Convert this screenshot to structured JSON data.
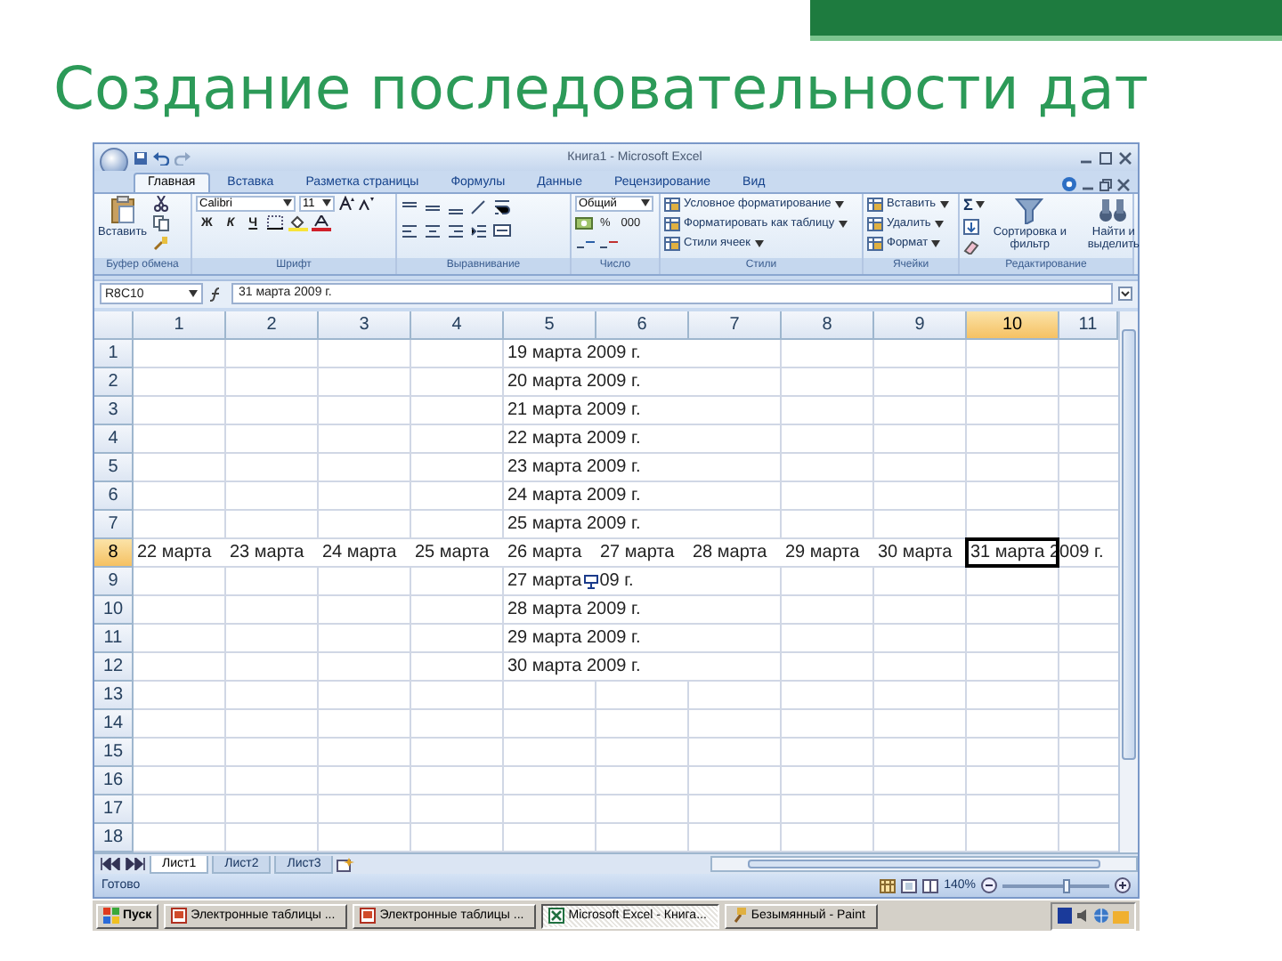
{
  "slide": {
    "title": "Создание последовательности дат"
  },
  "window": {
    "title": "Книга1 - Microsoft Excel"
  },
  "ribbon": {
    "tabs": [
      {
        "label": "Главная",
        "selected": true
      },
      {
        "label": "Вставка",
        "selected": false
      },
      {
        "label": "Разметка страницы",
        "selected": false
      },
      {
        "label": "Формулы",
        "selected": false
      },
      {
        "label": "Данные",
        "selected": false
      },
      {
        "label": "Рецензирование",
        "selected": false
      },
      {
        "label": "Вид",
        "selected": false
      }
    ],
    "groups": [
      {
        "name": "Буфер обмена",
        "kind": "clipboard",
        "label": "Вставить"
      },
      {
        "name": "Шрифт",
        "kind": "font",
        "font": "Calibri",
        "size": "11",
        "styles": [
          "Ж",
          "К",
          "Ч"
        ]
      },
      {
        "name": "Выравнивание",
        "kind": "align"
      },
      {
        "name": "Число",
        "kind": "number",
        "format": "Общий",
        "symbols": [
          "%",
          "000"
        ]
      },
      {
        "name": "Стили",
        "kind": "list",
        "items": [
          "Условное форматирование",
          "Форматировать как таблицу",
          "Стили ячеек"
        ]
      },
      {
        "name": "Ячейки",
        "kind": "list",
        "items": [
          "Вставить",
          "Удалить",
          "Формат"
        ]
      },
      {
        "name": "Редактирование",
        "kind": "edit",
        "sum": "Σ",
        "items": [
          "Сортировка и фильтр",
          "Найти и выделить"
        ]
      }
    ]
  },
  "formula_bar": {
    "name_box": "R8C10",
    "formula": "31 марта 2009 г."
  },
  "sheet": {
    "columns": [
      {
        "label": "1",
        "selected": false
      },
      {
        "label": "2",
        "selected": false
      },
      {
        "label": "3",
        "selected": false
      },
      {
        "label": "4",
        "selected": false
      },
      {
        "label": "5",
        "selected": false
      },
      {
        "label": "6",
        "selected": false
      },
      {
        "label": "7",
        "selected": false
      },
      {
        "label": "8",
        "selected": false
      },
      {
        "label": "9",
        "selected": false
      },
      {
        "label": "10",
        "selected": true
      },
      {
        "label": "11",
        "selected": false
      }
    ],
    "rows": [
      {
        "label": "1",
        "selected": false,
        "cells": [
          {
            "kind": "blank"
          },
          {
            "kind": "blank"
          },
          {
            "kind": "blank"
          },
          {
            "kind": "blank"
          },
          {
            "kind": "text",
            "text": "19 марта 2009 г.",
            "selected": false
          }
        ]
      },
      {
        "label": "2",
        "selected": false,
        "cells": [
          {
            "kind": "blank"
          },
          {
            "kind": "blank"
          },
          {
            "kind": "blank"
          },
          {
            "kind": "blank"
          },
          {
            "kind": "text",
            "text": "20 марта 2009 г.",
            "selected": false
          }
        ]
      },
      {
        "label": "3",
        "selected": false,
        "cells": [
          {
            "kind": "blank"
          },
          {
            "kind": "blank"
          },
          {
            "kind": "blank"
          },
          {
            "kind": "blank"
          },
          {
            "kind": "text",
            "text": "21 марта 2009 г.",
            "selected": false
          }
        ]
      },
      {
        "label": "4",
        "selected": false,
        "cells": [
          {
            "kind": "blank"
          },
          {
            "kind": "blank"
          },
          {
            "kind": "blank"
          },
          {
            "kind": "blank"
          },
          {
            "kind": "text",
            "text": "22 марта 2009 г.",
            "selected": false
          }
        ]
      },
      {
        "label": "5",
        "selected": false,
        "cells": [
          {
            "kind": "blank"
          },
          {
            "kind": "blank"
          },
          {
            "kind": "blank"
          },
          {
            "kind": "blank"
          },
          {
            "kind": "text",
            "text": "23 марта 2009 г.",
            "selected": false
          }
        ]
      },
      {
        "label": "6",
        "selected": false,
        "cells": [
          {
            "kind": "blank"
          },
          {
            "kind": "blank"
          },
          {
            "kind": "blank"
          },
          {
            "kind": "blank"
          },
          {
            "kind": "text",
            "text": "24 марта 2009 г.",
            "selected": false
          }
        ]
      },
      {
        "label": "7",
        "selected": false,
        "cells": [
          {
            "kind": "blank"
          },
          {
            "kind": "blank"
          },
          {
            "kind": "blank"
          },
          {
            "kind": "blank"
          },
          {
            "kind": "text",
            "text": "25 марта 2009 г.",
            "selected": false
          }
        ]
      },
      {
        "label": "8",
        "selected": true,
        "cells": [
          {
            "kind": "text",
            "text": "22 марта",
            "selected": false
          },
          {
            "kind": "text",
            "text": "23 марта",
            "selected": false
          },
          {
            "kind": "text",
            "text": "24 марта",
            "selected": false
          },
          {
            "kind": "text",
            "text": "25 марта",
            "selected": false
          },
          {
            "kind": "text",
            "text": "26 марта",
            "selected": false
          },
          {
            "kind": "text",
            "text": "27 марта",
            "selected": false
          },
          {
            "kind": "text",
            "text": "28 марта",
            "selected": false
          },
          {
            "kind": "text",
            "text": "29 марта",
            "selected": false
          },
          {
            "kind": "text",
            "text": "30 марта",
            "selected": false
          },
          {
            "kind": "text",
            "text": "31 марта 2009 г.",
            "selected": true
          }
        ]
      },
      {
        "label": "9",
        "selected": false,
        "cells": [
          {
            "kind": "blank"
          },
          {
            "kind": "blank"
          },
          {
            "kind": "blank"
          },
          {
            "kind": "blank"
          },
          {
            "kind": "autofill",
            "text": "27 марта",
            "covered_text": "09 г.",
            "selected": false
          }
        ]
      },
      {
        "label": "10",
        "selected": false,
        "cells": [
          {
            "kind": "blank"
          },
          {
            "kind": "blank"
          },
          {
            "kind": "blank"
          },
          {
            "kind": "blank"
          },
          {
            "kind": "text",
            "text": "28 марта 2009 г.",
            "selected": false
          }
        ]
      },
      {
        "label": "11",
        "selected": false,
        "cells": [
          {
            "kind": "blank"
          },
          {
            "kind": "blank"
          },
          {
            "kind": "blank"
          },
          {
            "kind": "blank"
          },
          {
            "kind": "text",
            "text": "29 марта 2009 г.",
            "selected": false
          }
        ]
      },
      {
        "label": "12",
        "selected": false,
        "cells": [
          {
            "kind": "blank"
          },
          {
            "kind": "blank"
          },
          {
            "kind": "blank"
          },
          {
            "kind": "blank"
          },
          {
            "kind": "text",
            "text": "30 марта 2009 г.",
            "selected": false
          }
        ]
      },
      {
        "label": "13",
        "selected": false
      },
      {
        "label": "14",
        "selected": false
      },
      {
        "label": "15",
        "selected": false
      },
      {
        "label": "16",
        "selected": false
      },
      {
        "label": "17",
        "selected": false
      },
      {
        "label": "18",
        "selected": false
      }
    ]
  },
  "sheet_tabs": [
    {
      "label": "Лист1",
      "selected": true
    },
    {
      "label": "Лист2",
      "selected": false
    },
    {
      "label": "Лист3",
      "selected": false
    }
  ],
  "status_bar": {
    "text": "Готово",
    "zoom": "140%",
    "zoom_slider": {
      "level": 0.6
    }
  },
  "taskbar": {
    "start": "Пуск",
    "items": [
      {
        "label": "Электронные таблицы ...",
        "selected": false
      },
      {
        "label": "Электронные таблицы ...",
        "selected": false
      },
      {
        "label": "Microsoft Excel - Книга...",
        "selected": true
      },
      {
        "label": "Безымянный - Paint",
        "selected": false
      }
    ]
  }
}
